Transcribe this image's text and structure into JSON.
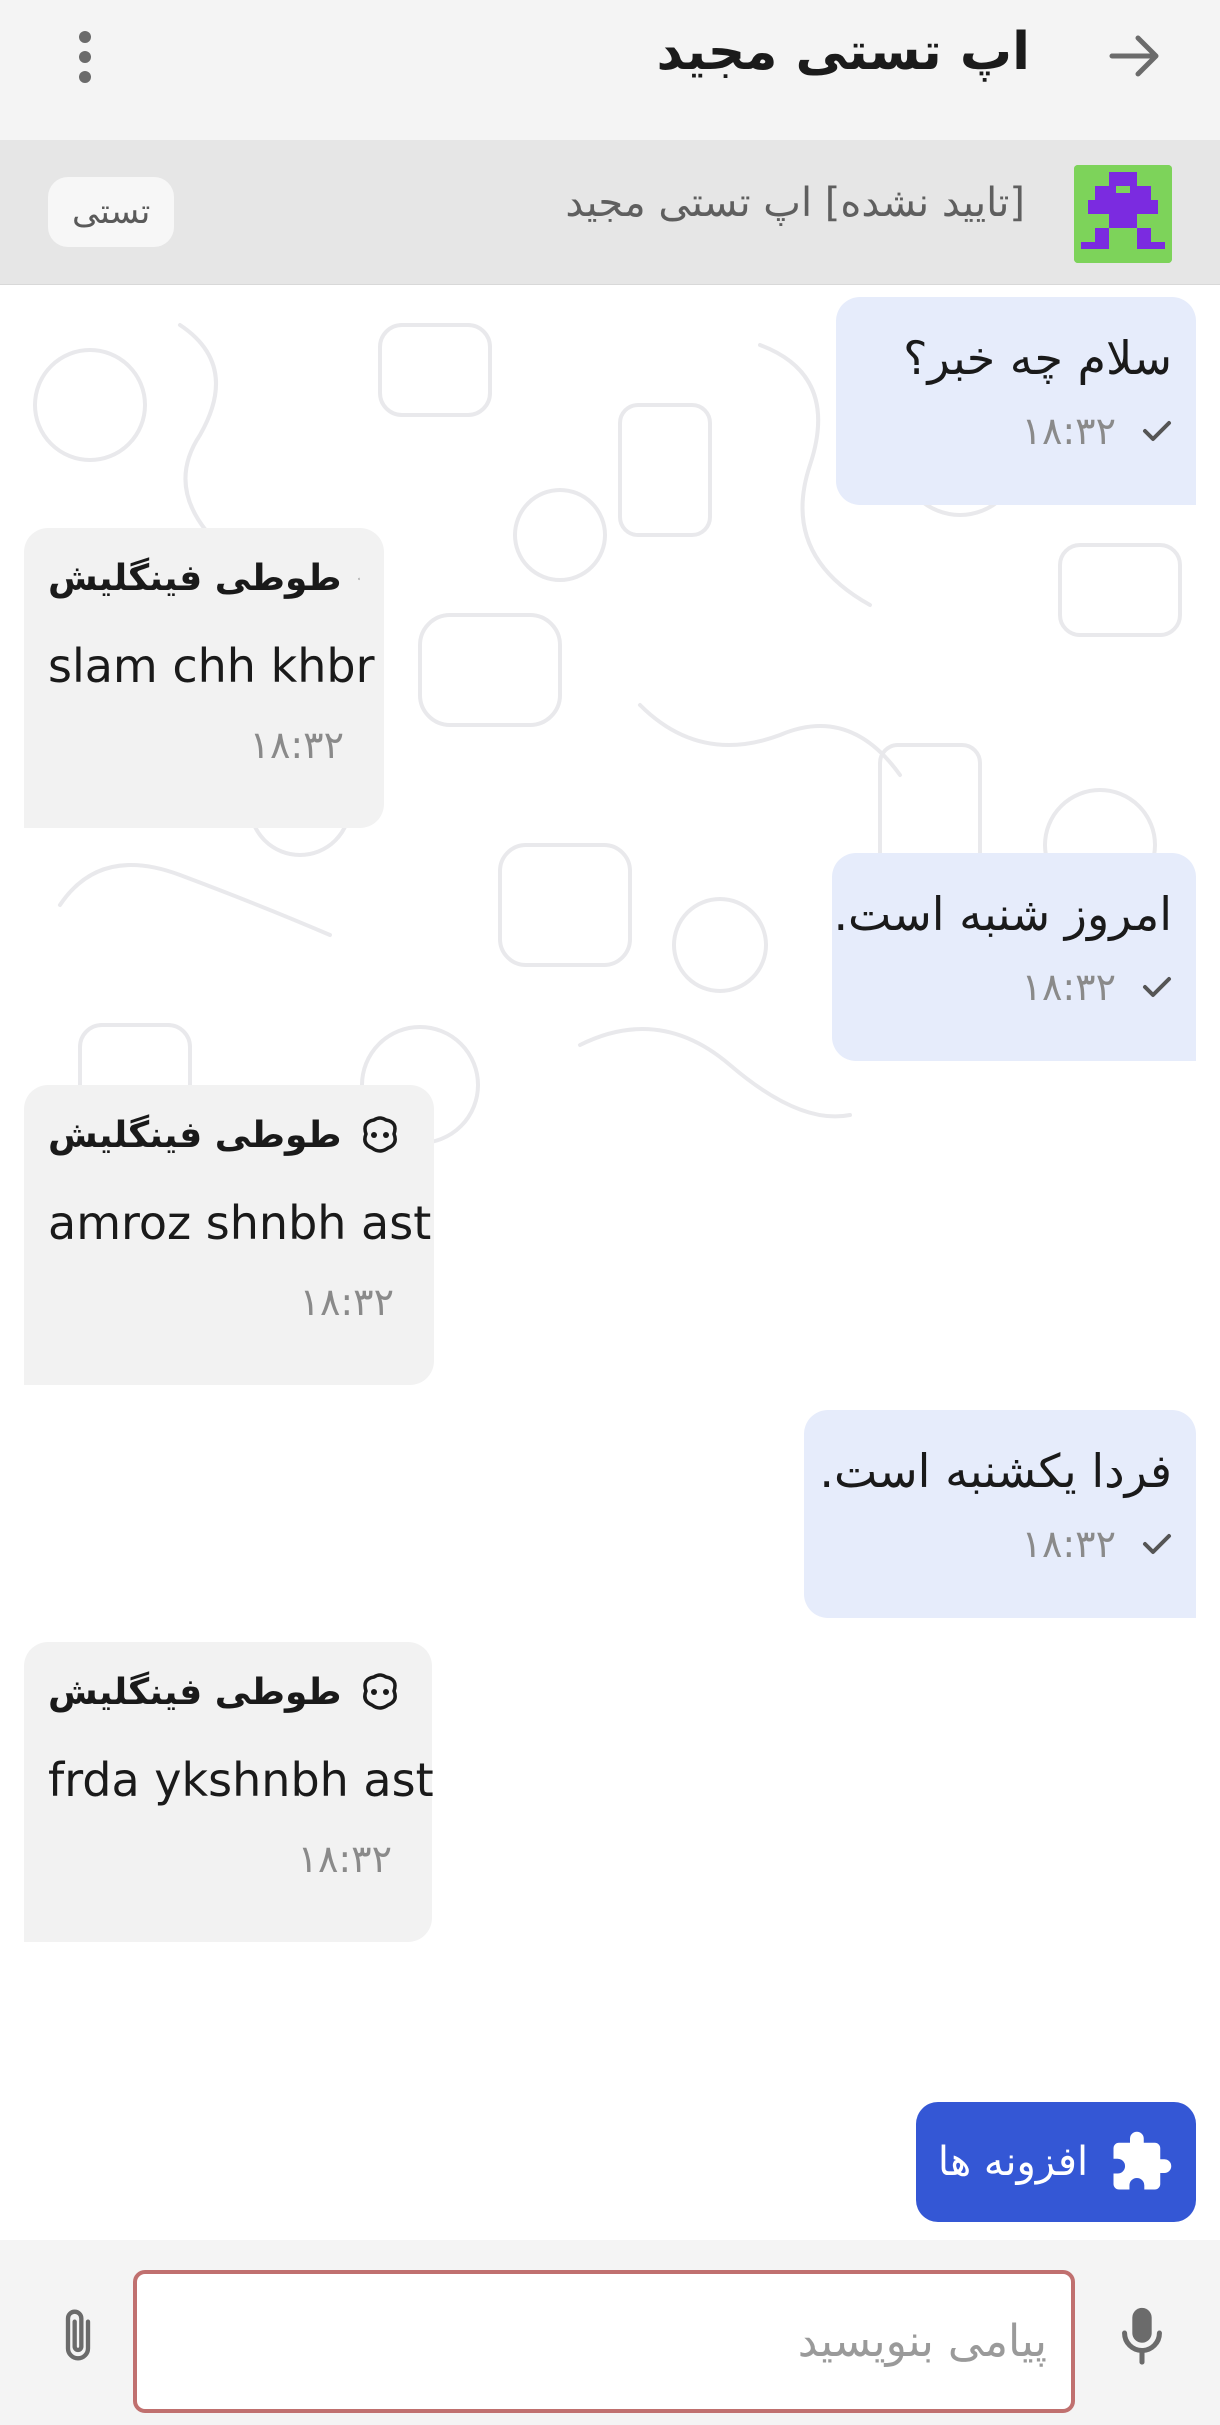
{
  "header": {
    "title": "اپ تستی مجید",
    "back_icon": "arrow-right-icon",
    "menu_icon": "more-vertical-icon"
  },
  "bot_bar": {
    "name": "[تایید نشده] اپ تستی مجید",
    "tag": "تستی",
    "avatar_icon": "pixel-robot-avatar"
  },
  "messages": [
    {
      "direction": "out",
      "text": "سلام چه خبر؟",
      "time": "۱۸:۳۲",
      "status_icon": "check-icon"
    },
    {
      "direction": "in",
      "sender": "طوطی فینگلیش",
      "sender_icon": "bot-icon",
      "text": "slam chh khbr",
      "time": "۱۸:۳۲"
    },
    {
      "direction": "out",
      "text": "امروز شنبه است.",
      "time": "۱۸:۳۲",
      "status_icon": "check-icon"
    },
    {
      "direction": "in",
      "sender": "طوطی فینگلیش",
      "sender_icon": "bot-icon",
      "text": "amroz shnbh ast",
      "time": "۱۸:۳۲"
    },
    {
      "direction": "out",
      "text": "فردا یکشنبه است.",
      "time": "۱۸:۳۲",
      "status_icon": "check-icon"
    },
    {
      "direction": "in",
      "sender": "طوطی فینگلیش",
      "sender_icon": "bot-icon",
      "text": "frda ykshnbh ast",
      "time": "۱۸:۳۲"
    }
  ],
  "plugins_button": {
    "label": "افزونه ها",
    "icon": "puzzle-icon"
  },
  "composer": {
    "placeholder": "پیامی بنویسید",
    "value": "",
    "attach_icon": "paperclip-icon",
    "mic_icon": "microphone-icon"
  },
  "colors": {
    "accent": "#3457d5",
    "outgoing_bubble": "#e6ecfb",
    "incoming_bubble": "#f2f2f2",
    "input_border": "#c0706f",
    "avatar_bg": "#7dd35a",
    "avatar_fg": "#7b2be0"
  }
}
